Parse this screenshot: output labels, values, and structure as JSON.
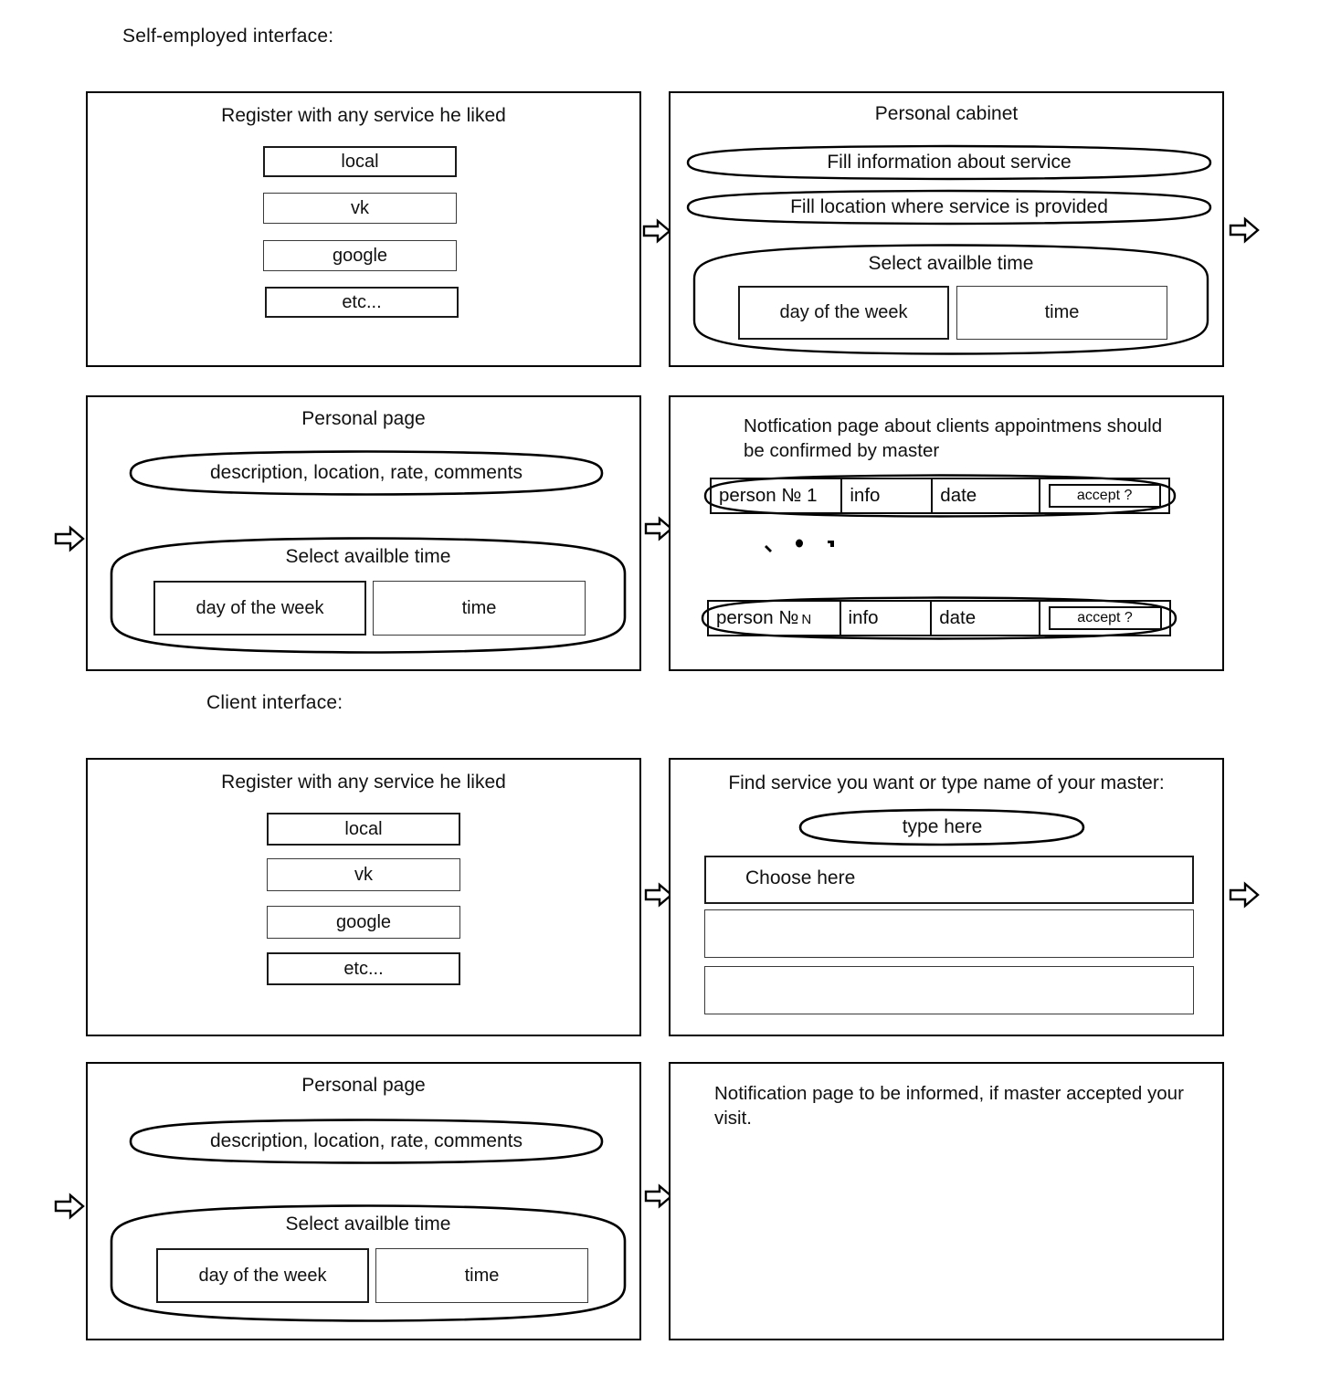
{
  "sections": [
    {
      "id": "self-employed",
      "label": "Self-employed interface:"
    },
    {
      "id": "client",
      "label": "Client  interface:"
    }
  ],
  "panels": {
    "register_self": {
      "title": "Register with any service he liked",
      "buttons": [
        "local",
        "vk",
        "google",
        "etc..."
      ]
    },
    "personal_cabinet": {
      "title": "Personal cabinet",
      "fill_service": "Fill information about service",
      "fill_location": "Fill location where service is provided",
      "select_time_title": "Select availble time",
      "day_box": "day of the week",
      "time_box": "time"
    },
    "personal_page_self": {
      "title": "Personal page",
      "description_capsule": "description, location, rate, comments",
      "select_time_title": "Select availble time",
      "day_box": "day of the week",
      "time_box": "time"
    },
    "notification_master": {
      "title": "Notfication page about clients appointmens should be confirmed by master",
      "columns": [
        "person",
        "info",
        "date",
        "accept"
      ],
      "rows": [
        {
          "person": "person № 1",
          "person_suffix": "",
          "info": "info",
          "date": "date",
          "accept": "accept ?"
        },
        {
          "person": "person №",
          "person_suffix": "N",
          "info": "info",
          "date": "date",
          "accept": "accept ?"
        }
      ],
      "ellipsis": "..."
    },
    "register_client": {
      "title": "Register with any service he liked",
      "buttons": [
        "local",
        "vk",
        "google",
        "etc..."
      ]
    },
    "find_service": {
      "title": "Find service you want or type name of your master:",
      "search_capsule": "type here",
      "choose_row": "Choose here",
      "empty_rows": [
        "",
        ""
      ]
    },
    "personal_page_client": {
      "title": "Personal page",
      "description_capsule": "description, location, rate, comments",
      "select_time_title": "Select availble time",
      "day_box": "day of the week",
      "time_box": "time"
    },
    "notification_client": {
      "title": "Notification page to be informed, if master accepted your visit."
    }
  },
  "arrows": {
    "icon": "right-block-arrow",
    "count": 7
  },
  "colors": {
    "stroke": "#000000",
    "background": "#ffffff",
    "text": "#111111"
  }
}
